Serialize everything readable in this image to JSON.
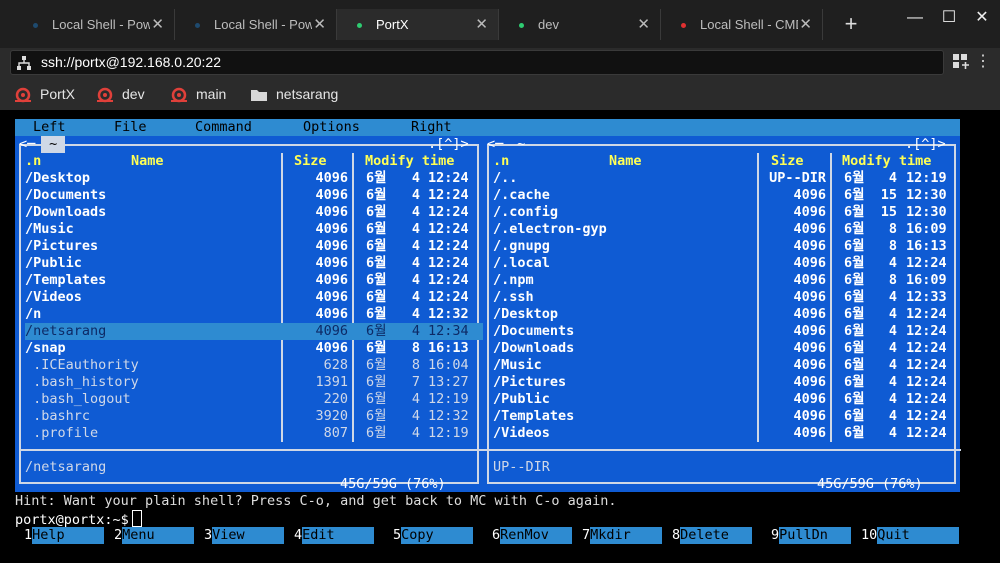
{
  "tabs": [
    {
      "label": "Local Shell - Powersh",
      "dot_color": "#1e4a6e",
      "active": false
    },
    {
      "label": "Local Shell - Powersh",
      "dot_color": "#1e4a6e",
      "active": false
    },
    {
      "label": "PortX",
      "dot_color": "#2ecc71",
      "active": true
    },
    {
      "label": "dev",
      "dot_color": "#2ecc71",
      "active": false
    },
    {
      "label": "Local Shell - CMD",
      "dot_color": "#e03030",
      "active": false
    }
  ],
  "tab_close": "✕",
  "new_tab": "+",
  "window_controls": {
    "minimize": "—",
    "maximize": "☐",
    "close": "✕"
  },
  "address": "ssh://portx@192.168.0.20:22",
  "address_more": "⋮",
  "bookmarks": [
    {
      "label": "PortX",
      "icon": "snail-icon"
    },
    {
      "label": "dev",
      "icon": "snail-icon"
    },
    {
      "label": "main",
      "icon": "snail-icon"
    },
    {
      "label": "netsarang",
      "icon": "folder-icon"
    }
  ],
  "mc_menu": [
    "Left",
    "File",
    "Command",
    "Options",
    "Right"
  ],
  "left_panel": {
    "path": "~",
    "corner": ".[^]>",
    "corner_left": "<",
    "headers": {
      "n": ".n",
      "name": "Name",
      "size": "Size",
      "modify": "Modify time"
    },
    "rows": [
      {
        "name": "/Desktop",
        "size": "4096",
        "month": "6월",
        "day": "4",
        "time": "12:24",
        "dir": true
      },
      {
        "name": "/Documents",
        "size": "4096",
        "month": "6월",
        "day": "4",
        "time": "12:24",
        "dir": true
      },
      {
        "name": "/Downloads",
        "size": "4096",
        "month": "6월",
        "day": "4",
        "time": "12:24",
        "dir": true
      },
      {
        "name": "/Music",
        "size": "4096",
        "month": "6월",
        "day": "4",
        "time": "12:24",
        "dir": true
      },
      {
        "name": "/Pictures",
        "size": "4096",
        "month": "6월",
        "day": "4",
        "time": "12:24",
        "dir": true
      },
      {
        "name": "/Public",
        "size": "4096",
        "month": "6월",
        "day": "4",
        "time": "12:24",
        "dir": true
      },
      {
        "name": "/Templates",
        "size": "4096",
        "month": "6월",
        "day": "4",
        "time": "12:24",
        "dir": true
      },
      {
        "name": "/Videos",
        "size": "4096",
        "month": "6월",
        "day": "4",
        "time": "12:24",
        "dir": true
      },
      {
        "name": "/n",
        "size": "4096",
        "month": "6월",
        "day": "4",
        "time": "12:32",
        "dir": true
      },
      {
        "name": "/netsarang",
        "size": "4096",
        "month": "6월",
        "day": "4",
        "time": "12:34",
        "dir": true,
        "selected": true
      },
      {
        "name": "/snap",
        "size": "4096",
        "month": "6월",
        "day": "8",
        "time": "16:13",
        "dir": true
      },
      {
        "name": " .ICEauthority",
        "size": "628",
        "month": "6월",
        "day": "8",
        "time": "16:04",
        "dir": false
      },
      {
        "name": " .bash_history",
        "size": "1391",
        "month": "6월",
        "day": "7",
        "time": "13:27",
        "dir": false
      },
      {
        "name": " .bash_logout",
        "size": "220",
        "month": "6월",
        "day": "4",
        "time": "12:19",
        "dir": false
      },
      {
        "name": " .bashrc",
        "size": "3920",
        "month": "6월",
        "day": "4",
        "time": "12:32",
        "dir": false
      },
      {
        "name": " .profile",
        "size": "807",
        "month": "6월",
        "day": "4",
        "time": "12:19",
        "dir": false
      }
    ],
    "status": "/netsarang",
    "disk": "45G/59G (76%)"
  },
  "right_panel": {
    "path": "~",
    "corner": ".[^]>",
    "corner_left": "<",
    "headers": {
      "n": ".n",
      "name": "Name",
      "size": "Size",
      "modify": "Modify time"
    },
    "rows": [
      {
        "name": "/..",
        "size": "UP--DIR",
        "month": "6월",
        "day": "4",
        "time": "12:19",
        "dir": true
      },
      {
        "name": "/.cache",
        "size": "4096",
        "month": "6월",
        "day": "15",
        "time": "12:30",
        "dir": true
      },
      {
        "name": "/.config",
        "size": "4096",
        "month": "6월",
        "day": "15",
        "time": "12:30",
        "dir": true
      },
      {
        "name": "/.electron-gyp",
        "size": "4096",
        "month": "6월",
        "day": "8",
        "time": "16:09",
        "dir": true
      },
      {
        "name": "/.gnupg",
        "size": "4096",
        "month": "6월",
        "day": "8",
        "time": "16:13",
        "dir": true
      },
      {
        "name": "/.local",
        "size": "4096",
        "month": "6월",
        "day": "4",
        "time": "12:24",
        "dir": true
      },
      {
        "name": "/.npm",
        "size": "4096",
        "month": "6월",
        "day": "8",
        "time": "16:09",
        "dir": true
      },
      {
        "name": "/.ssh",
        "size": "4096",
        "month": "6월",
        "day": "4",
        "time": "12:33",
        "dir": true
      },
      {
        "name": "/Desktop",
        "size": "4096",
        "month": "6월",
        "day": "4",
        "time": "12:24",
        "dir": true
      },
      {
        "name": "/Documents",
        "size": "4096",
        "month": "6월",
        "day": "4",
        "time": "12:24",
        "dir": true
      },
      {
        "name": "/Downloads",
        "size": "4096",
        "month": "6월",
        "day": "4",
        "time": "12:24",
        "dir": true
      },
      {
        "name": "/Music",
        "size": "4096",
        "month": "6월",
        "day": "4",
        "time": "12:24",
        "dir": true
      },
      {
        "name": "/Pictures",
        "size": "4096",
        "month": "6월",
        "day": "4",
        "time": "12:24",
        "dir": true
      },
      {
        "name": "/Public",
        "size": "4096",
        "month": "6월",
        "day": "4",
        "time": "12:24",
        "dir": true
      },
      {
        "name": "/Templates",
        "size": "4096",
        "month": "6월",
        "day": "4",
        "time": "12:24",
        "dir": true
      },
      {
        "name": "/Videos",
        "size": "4096",
        "month": "6월",
        "day": "4",
        "time": "12:24",
        "dir": true
      }
    ],
    "status": "UP--DIR",
    "disk": "45G/59G (76%)"
  },
  "hint": "Hint: Want your plain shell? Press C-o, and get back to MC with C-o again.",
  "prompt": "portx@portx:~$",
  "fkeys": [
    {
      "num": "1",
      "label": "Help"
    },
    {
      "num": "2",
      "label": "Menu"
    },
    {
      "num": "3",
      "label": "View"
    },
    {
      "num": "4",
      "label": "Edit"
    },
    {
      "num": "5",
      "label": "Copy"
    },
    {
      "num": "6",
      "label": "RenMov"
    },
    {
      "num": "7",
      "label": "Mkdir"
    },
    {
      "num": "8",
      "label": "Delete"
    },
    {
      "num": "9",
      "label": "PullDn"
    },
    {
      "num": "10",
      "label": "Quit"
    }
  ]
}
